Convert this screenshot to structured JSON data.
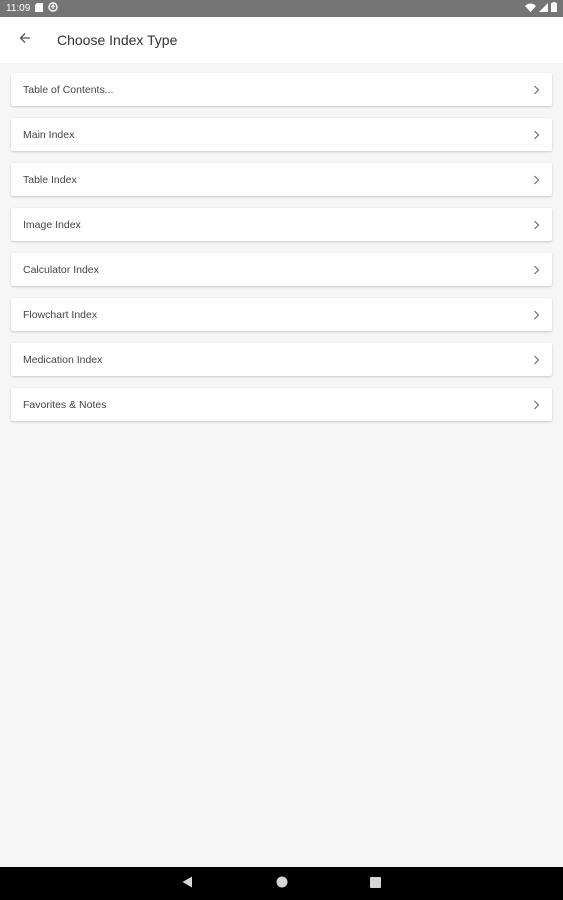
{
  "status_bar": {
    "time": "11:09",
    "left_icons": [
      "sd-card-icon",
      "sync-icon"
    ],
    "right_icons": [
      "wifi-icon",
      "signal-icon",
      "battery-icon"
    ]
  },
  "app_bar": {
    "back_icon": "arrow-back-icon",
    "title": "Choose Index Type"
  },
  "list": {
    "items": [
      {
        "label": "Table of Contents...",
        "icon": "chevron-right-icon"
      },
      {
        "label": "Main Index",
        "icon": "chevron-right-icon"
      },
      {
        "label": "Table Index",
        "icon": "chevron-right-icon"
      },
      {
        "label": "Image Index",
        "icon": "chevron-right-icon"
      },
      {
        "label": "Calculator Index",
        "icon": "chevron-right-icon"
      },
      {
        "label": "Flowchart Index",
        "icon": "chevron-right-icon"
      },
      {
        "label": "Medication Index",
        "icon": "chevron-right-icon"
      },
      {
        "label": "Favorites & Notes",
        "icon": "chevron-right-icon"
      }
    ]
  },
  "nav_bar": {
    "buttons": [
      "back-triangle-icon",
      "home-circle-icon",
      "recents-square-icon"
    ]
  },
  "colors": {
    "status_bar": "#757575",
    "app_bar": "#ffffff",
    "background": "#f6f6f6",
    "nav_bar": "#000000",
    "text": "#444444"
  }
}
